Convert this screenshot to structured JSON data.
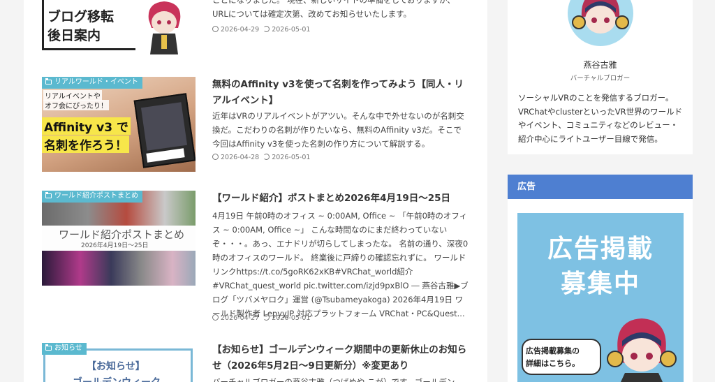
{
  "articles": [
    {
      "thumb_text": [
        "ブログ移転",
        "後日案内"
      ],
      "excerpt": "ことになりました。 現在、新しいサイトの準備をしておりますが、URLについては確定次第、改めてお知らせいたします。",
      "date_posted": "2026-04-29",
      "date_updated": "2026-05-01"
    },
    {
      "category": "リアルワールド・イベント",
      "thumb_text": [
        "リアルイベントや",
        "オフ会にぴったり！",
        "Affinity v3 で",
        "名刺を作ろう！"
      ],
      "title": "無料のAffinity v3を使って名刺を作ってみよう【同人・リアルイベント】",
      "excerpt": "近年はVRのリアルイベントがアツい。そんな中で外せないのが名刺交換だ。こだわりの名刺が作りたいなら、無料のAffinity v3だ。そこで今回はAffinity v3を使った名刺の作り方について解説する。",
      "date_posted": "2026-04-28",
      "date_updated": "2026-05-01"
    },
    {
      "category": "ワールド紹介ポストまとめ",
      "thumb_text": [
        "ワールド紹介ポストまとめ",
        "2026年4月19日～25日"
      ],
      "title": "【ワールド紹介】ポストまとめ2026年4月19日～25日",
      "excerpt": "4月19日 午前0時のオフィス ~ 0:00AM, Office ~ 「午前0時のオフィス ~ 0:00AM, Office ~」 こんな時間なのにまだ終わっていないぞ・・・。あっ、エナドリが切らしてしまったな。 名前の通り、深夜0時のオフィスのワールド。 終業後に戸締りの確認忘れずに。 ワールドリンクhttps://t.co/5goRK62xKB#VRChat_world紹介#VRChat_quest_world pic.twitter.com/izjd9pxBlO ― 燕谷古雅▶ブログ「ツバメヤロク」運営 (@Tsubameyakoga) 2026年4月19日 ワールド製作者 LepyyJP 対応プラットフォーム VRChat・PC&Quest...",
      "date_posted": "2026-04-27",
      "date_updated": "2026-05-01"
    },
    {
      "category": "お知らせ",
      "thumb_text": [
        "【お知らせ】",
        "ゴールデンウィーク"
      ],
      "title": "【お知らせ】ゴールデンウィーク期間中の更新休止のお知らせ（2026年5月2日～9日更新分）※変更あり",
      "excerpt": "バーチャルブロガーの燕谷古雅（つばめや こが）です。ゴールデン"
    }
  ],
  "profile": {
    "name": "燕谷古雅",
    "role": "バーチャルブロガー",
    "bio": "ソーシャルVRのことを発信するブロガー。VRChatやclusterといったVR世界のワールドやイベント、コミュニティなどのレビュー・紹介中心にライトユーザー目線で発信。"
  },
  "ad": {
    "heading": "広告",
    "banner_big": [
      "広告掲載",
      "募集中"
    ],
    "banner_small": [
      "広告掲載募集の",
      "詳細はこちら。"
    ]
  },
  "colors": {
    "category_badge": "#5bb9cf",
    "ad_header": "#4e7fd1",
    "ad_banner": "#7ec1e3"
  }
}
